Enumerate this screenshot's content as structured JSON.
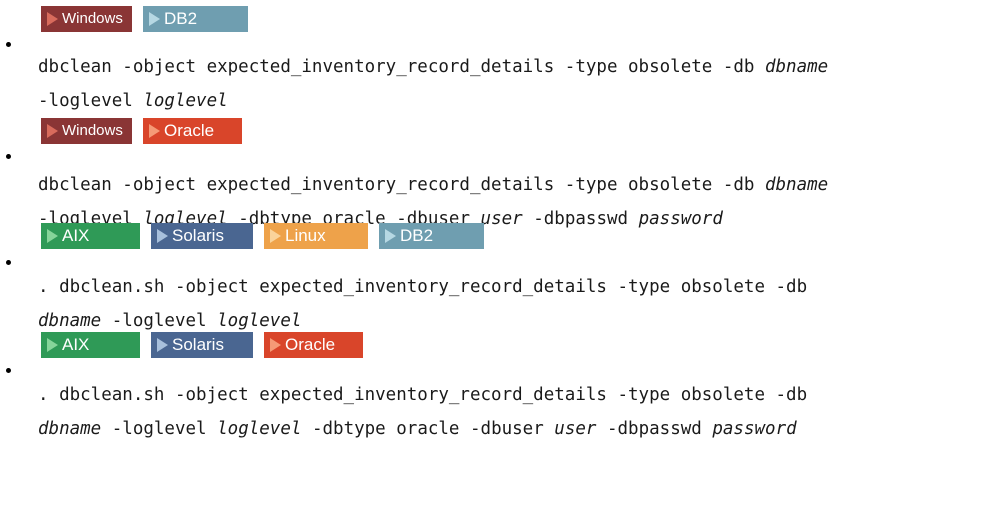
{
  "tag_colors": {
    "Windows": {
      "bg": "#8a3535",
      "arrow": "#d86b5c"
    },
    "DB2": {
      "bg": "#6f9eb0",
      "arrow": "#b6d8e3"
    },
    "Oracle": {
      "bg": "#d9452a",
      "arrow": "#f59a76"
    },
    "AIX": {
      "bg": "#2f9a57",
      "arrow": "#86d59a"
    },
    "Solaris": {
      "bg": "#4a6691",
      "arrow": "#a8c0dc"
    },
    "Linux": {
      "bg": "#eea24a",
      "arrow": "#fad39a"
    }
  },
  "entries": [
    {
      "tags": [
        "Windows",
        "DB2"
      ],
      "line1": [
        "dbclean -object expected_inventory_record_details -type obsolete -db ",
        {
          "i": "dbname"
        }
      ],
      "line2": [
        "-loglevel ",
        {
          "i": "loglevel"
        }
      ]
    },
    {
      "tags": [
        "Windows",
        "Oracle"
      ],
      "line1": [
        "dbclean -object expected_inventory_record_details -type obsolete -db ",
        {
          "i": "dbname"
        }
      ],
      "line2": [
        "-loglevel ",
        {
          "i": "loglevel"
        },
        " -dbtype oracle -dbuser ",
        {
          "i": "user"
        },
        " -dbpasswd ",
        {
          "i": "password"
        }
      ]
    },
    {
      "tags": [
        "AIX",
        "Solaris",
        "Linux",
        "DB2"
      ],
      "line1": [
        ". dbclean.sh -object expected_inventory_record_details -type obsolete -db"
      ],
      "line2": [
        {
          "i": "dbname"
        },
        " -loglevel ",
        {
          "i": "loglevel"
        }
      ]
    },
    {
      "tags": [
        "AIX",
        "Solaris",
        "Oracle"
      ],
      "line1": [
        ". dbclean.sh -object expected_inventory_record_details -type obsolete -db"
      ],
      "line2": [
        {
          "i": "dbname"
        },
        " -loglevel ",
        {
          "i": "loglevel"
        },
        " -dbtype oracle -dbuser ",
        {
          "i": "user"
        },
        " -dbpasswd ",
        {
          "i": "password"
        }
      ]
    }
  ]
}
